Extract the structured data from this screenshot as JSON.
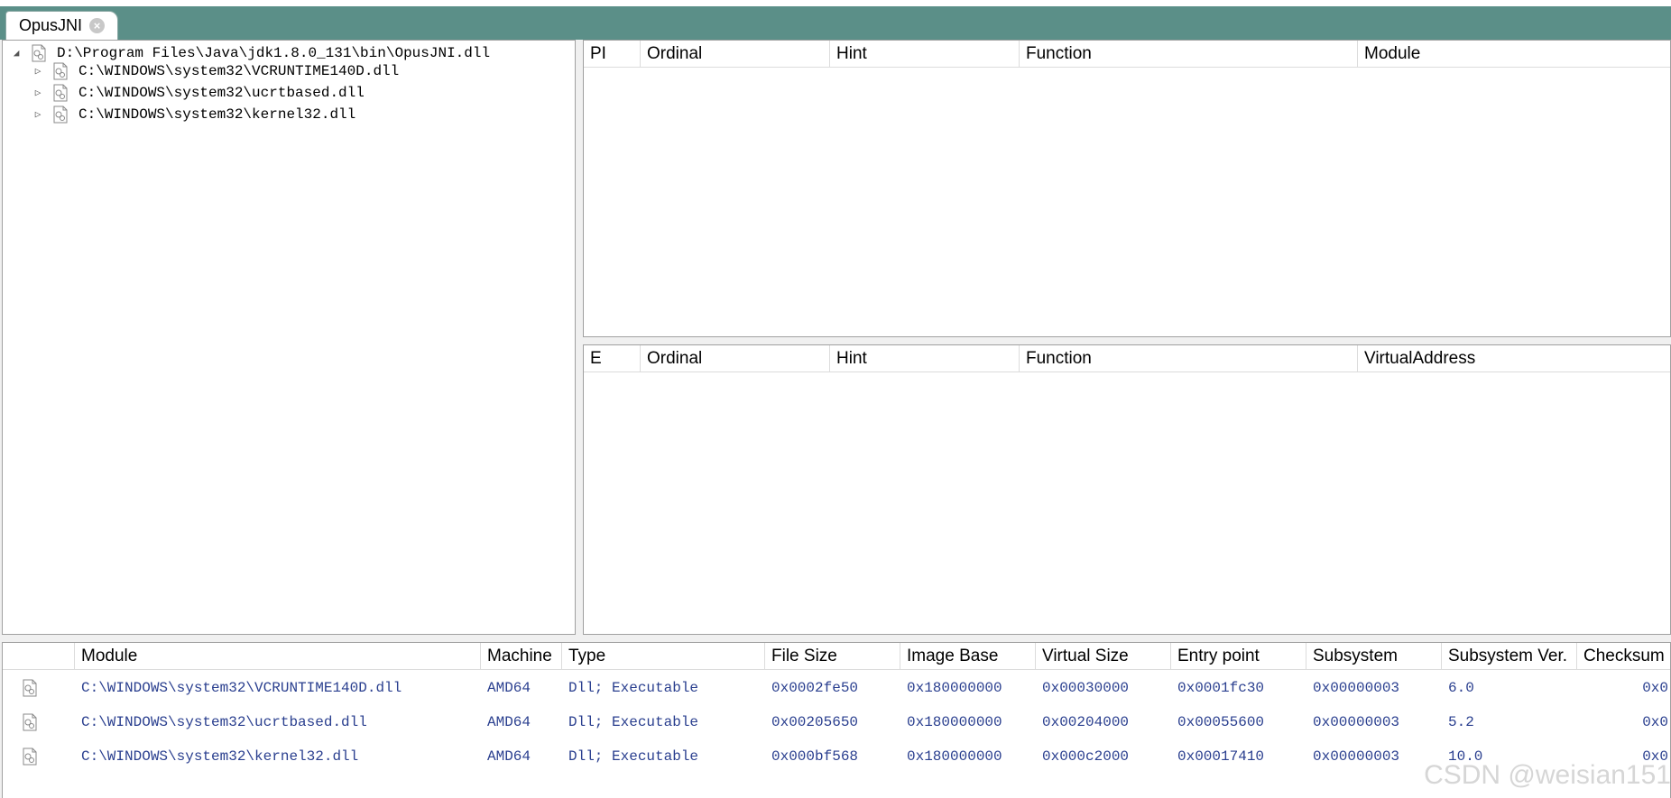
{
  "tab": {
    "title": "OpusJNI"
  },
  "tree": [
    {
      "path": "D:\\Program Files\\Java\\jdk1.8.0_131\\bin\\OpusJNI.dll",
      "expanded": true
    },
    {
      "path": "C:\\WINDOWS\\system32\\VCRUNTIME140D.dll",
      "expanded": false
    },
    {
      "path": "C:\\WINDOWS\\system32\\ucrtbased.dll",
      "expanded": false
    },
    {
      "path": "C:\\WINDOWS\\system32\\kernel32.dll",
      "expanded": false
    }
  ],
  "imports": {
    "columns": [
      "PI",
      "Ordinal",
      "Hint",
      "Function",
      "Module"
    ]
  },
  "exports": {
    "columns": [
      "E",
      "Ordinal",
      "Hint",
      "Function",
      "VirtualAddress"
    ]
  },
  "modules": {
    "columns": [
      "",
      "Module",
      "Machine",
      "Type",
      "File Size",
      "Image Base",
      "Virtual Size",
      "Entry point",
      "Subsystem",
      "Subsystem Ver.",
      "Checksum"
    ],
    "rows": [
      [
        "C:\\WINDOWS\\system32\\VCRUNTIME140D.dll",
        "AMD64",
        "Dll; Executable",
        "0x0002fe50",
        "0x180000000",
        "0x00030000",
        "0x0001fc30",
        "0x00000003",
        "6.0",
        "0x0"
      ],
      [
        "C:\\WINDOWS\\system32\\ucrtbased.dll",
        "AMD64",
        "Dll; Executable",
        "0x00205650",
        "0x180000000",
        "0x00204000",
        "0x00055600",
        "0x00000003",
        "5.2",
        "0x0"
      ],
      [
        "C:\\WINDOWS\\system32\\kernel32.dll",
        "AMD64",
        "Dll; Executable",
        "0x000bf568",
        "0x180000000",
        "0x000c2000",
        "0x00017410",
        "0x00000003",
        "10.0",
        "0x0"
      ]
    ]
  },
  "watermark": "CSDN @weisian151",
  "colors": {
    "tabbar": "#5b8f88",
    "module_text": "#2a3f8f"
  }
}
